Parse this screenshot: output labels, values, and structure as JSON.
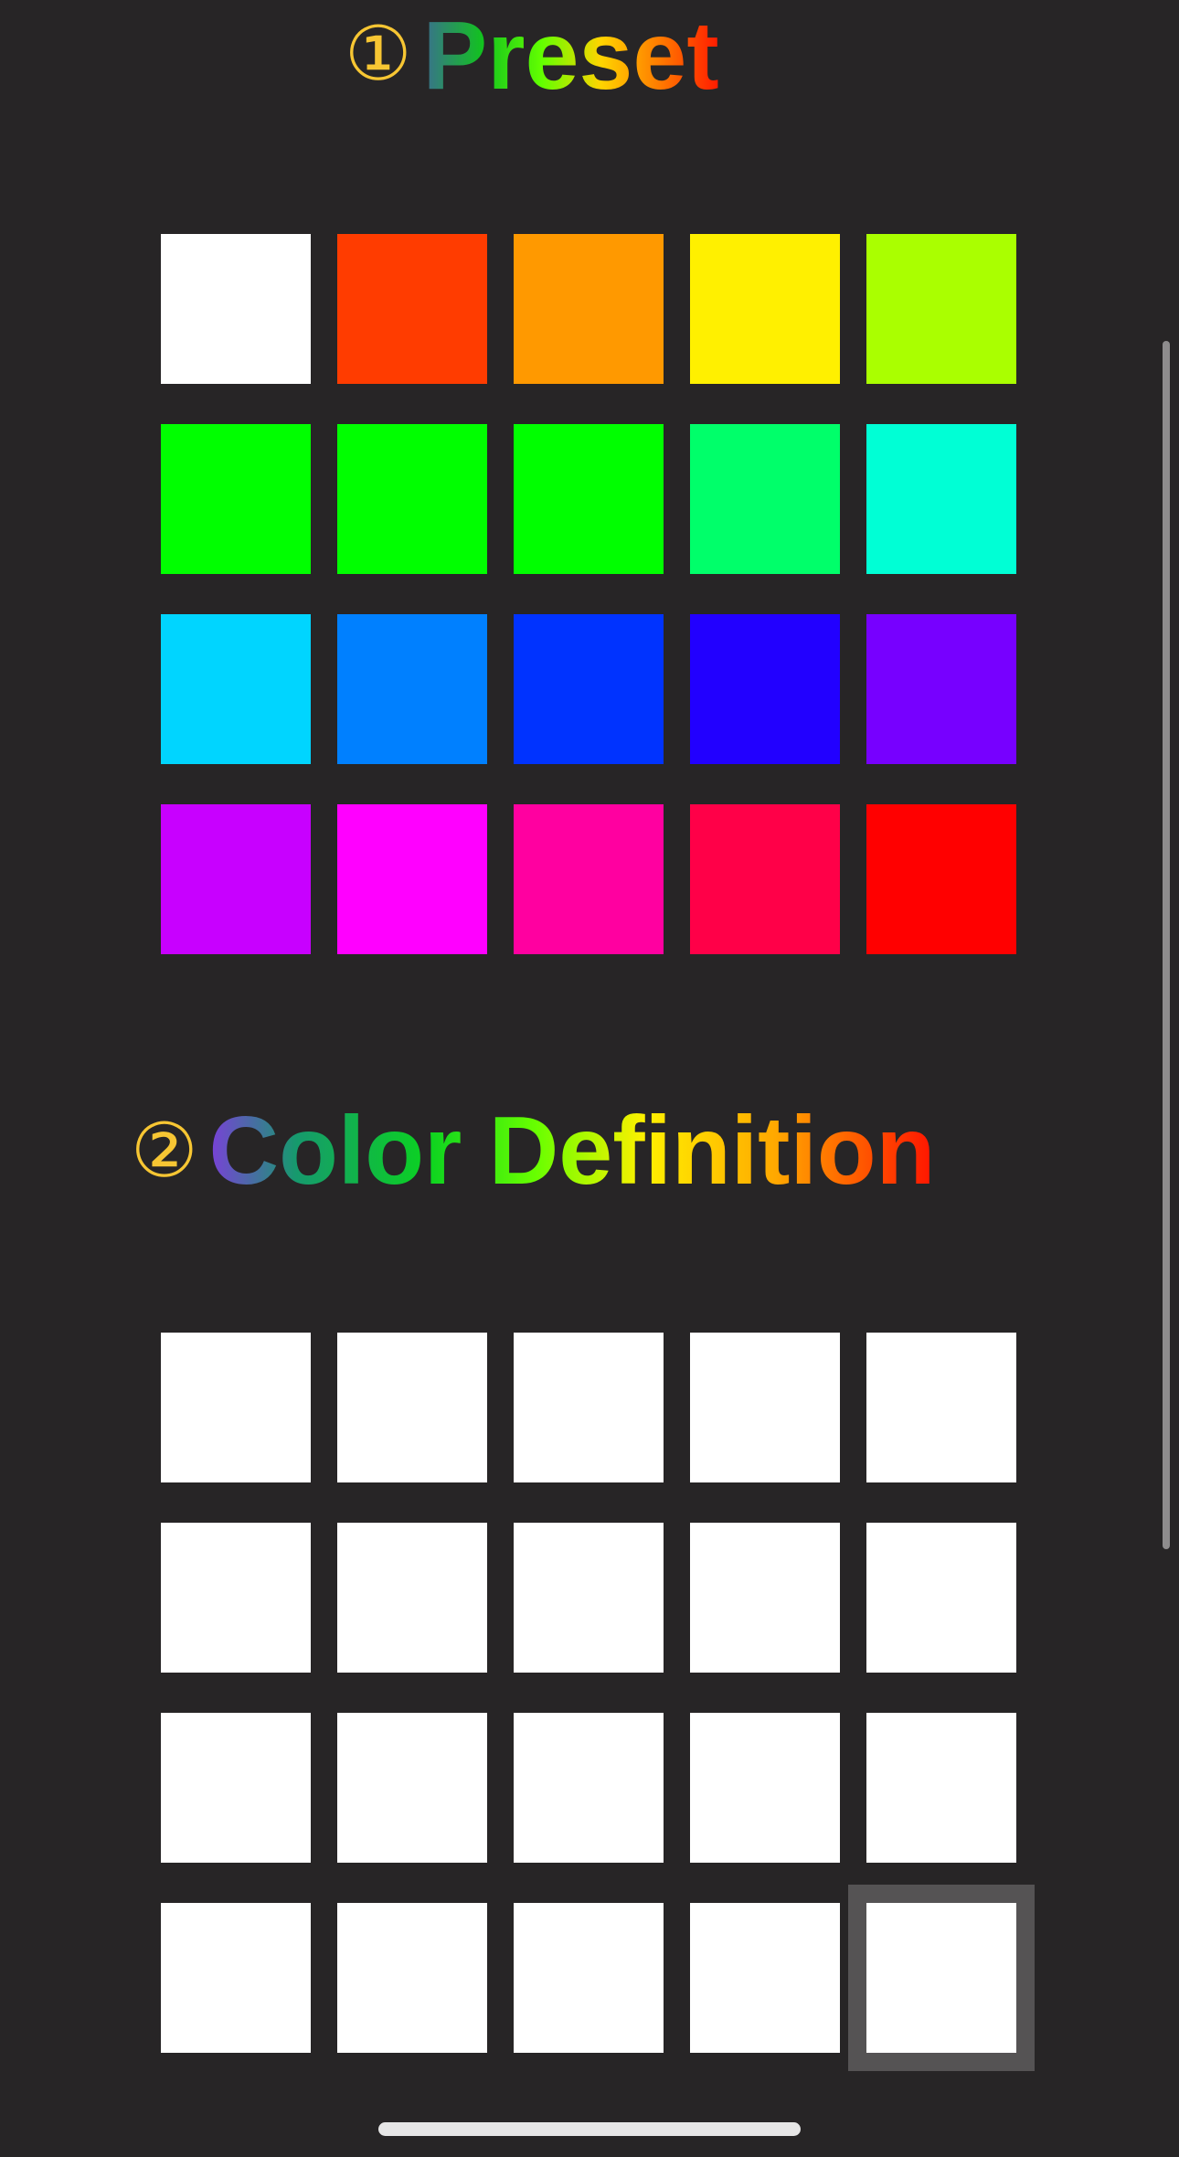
{
  "preset_section": {
    "number": "①",
    "title": "Preset",
    "swatches": [
      {
        "color": "#ffffff"
      },
      {
        "color": "#ff3c00"
      },
      {
        "color": "#ff9900"
      },
      {
        "color": "#fff000"
      },
      {
        "color": "#aaff00"
      },
      {
        "color": "#00ff00"
      },
      {
        "color": "#00ff00"
      },
      {
        "color": "#00ff00"
      },
      {
        "color": "#00ff6a"
      },
      {
        "color": "#00ffd5"
      },
      {
        "color": "#00d5ff"
      },
      {
        "color": "#0080ff"
      },
      {
        "color": "#0033ff"
      },
      {
        "color": "#2200ff"
      },
      {
        "color": "#7700ff"
      },
      {
        "color": "#c800ff"
      },
      {
        "color": "#ff00ff"
      },
      {
        "color": "#ff00a0"
      },
      {
        "color": "#ff0048"
      },
      {
        "color": "#ff0000"
      }
    ]
  },
  "color_definition_section": {
    "number": "②",
    "title": "Color Definition",
    "selected_index": 19,
    "swatches": [
      {
        "color": "#ffffff"
      },
      {
        "color": "#ffffff"
      },
      {
        "color": "#ffffff"
      },
      {
        "color": "#ffffff"
      },
      {
        "color": "#ffffff"
      },
      {
        "color": "#ffffff"
      },
      {
        "color": "#ffffff"
      },
      {
        "color": "#ffffff"
      },
      {
        "color": "#ffffff"
      },
      {
        "color": "#ffffff"
      },
      {
        "color": "#ffffff"
      },
      {
        "color": "#ffffff"
      },
      {
        "color": "#ffffff"
      },
      {
        "color": "#ffffff"
      },
      {
        "color": "#ffffff"
      },
      {
        "color": "#ffffff"
      },
      {
        "color": "#ffffff"
      },
      {
        "color": "#ffffff"
      },
      {
        "color": "#ffffff"
      },
      {
        "color": "#ffffff"
      }
    ]
  },
  "colors": {
    "background": "#272526",
    "number_accent": "#f7c633",
    "selection_outline": "#555354"
  }
}
